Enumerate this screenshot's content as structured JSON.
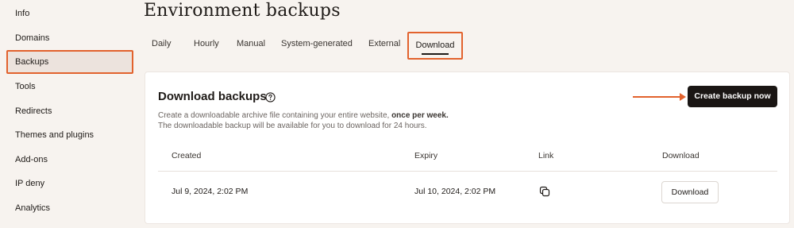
{
  "sidebar": {
    "items": [
      {
        "label": "Info"
      },
      {
        "label": "Domains"
      },
      {
        "label": "Backups",
        "active": true
      },
      {
        "label": "Tools"
      },
      {
        "label": "Redirects"
      },
      {
        "label": "Themes and plugins"
      },
      {
        "label": "Add-ons"
      },
      {
        "label": "IP deny"
      },
      {
        "label": "Analytics"
      }
    ]
  },
  "page": {
    "title": "Environment backups"
  },
  "tabs": [
    {
      "label": "Daily"
    },
    {
      "label": "Hourly"
    },
    {
      "label": "Manual"
    },
    {
      "label": "System-generated"
    },
    {
      "label": "External"
    },
    {
      "label": "Download",
      "active": true
    }
  ],
  "card": {
    "title": "Download backups",
    "help_icon": "question-circle-icon",
    "description_line1_prefix": "Create a downloadable archive file containing your entire website, ",
    "description_line1_bold": "once per week.",
    "description_line2": "The downloadable backup will be available for you to download for 24 hours.",
    "create_button_label": "Create backup now",
    "annotation_color": "#e2622d"
  },
  "table": {
    "headers": {
      "created": "Created",
      "expiry": "Expiry",
      "link": "Link",
      "download": "Download"
    },
    "rows": [
      {
        "created": "Jul 9, 2024, 2:02 PM",
        "expiry": "Jul 10, 2024, 2:02 PM",
        "link_icon": "copy-icon",
        "download_label": "Download"
      }
    ]
  }
}
